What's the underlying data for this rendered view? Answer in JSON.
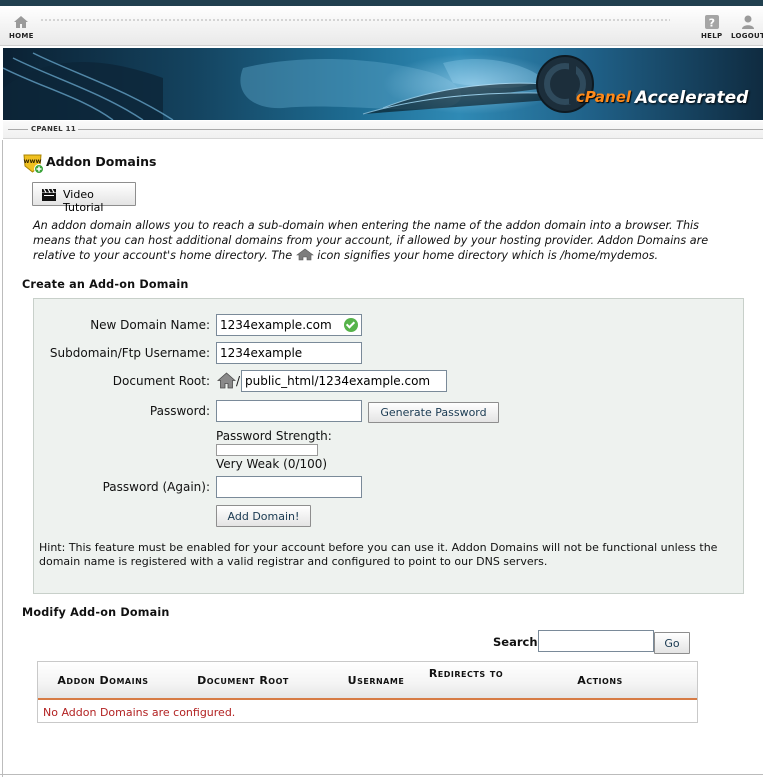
{
  "nav": {
    "home_label": "HOME",
    "help_label": "HELP",
    "logout_label": "LOGOUT"
  },
  "banner": {
    "brand_left": "cPanel",
    "brand_right": "Accelerated"
  },
  "breadcrumb": {
    "label": "CPANEL 11"
  },
  "page": {
    "title": "Addon Domains",
    "video_button": "Video Tutorial",
    "intro_part1": "An addon domain allows you to reach a sub-domain when entering the name of the addon domain into a browser. This means that you can host additional domains from your account, if allowed by your hosting provider. Addon Domains are relative to your account's home directory. The ",
    "intro_part2": " icon signifies your home directory which is /home/mydemos."
  },
  "create": {
    "heading": "Create an Add-on Domain",
    "fields": {
      "domain_label": "New Domain Name:",
      "domain_value": "1234example.com",
      "subdomain_label": "Subdomain/Ftp Username:",
      "subdomain_value": "1234example",
      "docroot_label": "Document Root:",
      "docroot_slash": "/",
      "docroot_value": "public_html/1234example.com",
      "password_label": "Password:",
      "password_value": "",
      "password_again_label": "Password (Again):",
      "password_again_value": ""
    },
    "generate_button": "Generate Password",
    "strength_label": "Password Strength:",
    "strength_value": "Very Weak (0/100)",
    "strength_score": 0,
    "add_button": "Add Domain!",
    "hint": "Hint: This feature must be enabled for your account before you can use it. Addon Domains will not be functional unless the domain name is registered with a valid registrar and configured to point to our DNS servers."
  },
  "modify": {
    "heading": "Modify Add-on Domain",
    "search_label": "Search",
    "search_value": "",
    "go_button": "Go",
    "columns": [
      "Addon Domains",
      "Document Root",
      "Username",
      "Redirects to",
      "Actions"
    ],
    "empty_message": "No Addon Domains are configured."
  },
  "colors": {
    "accent_orange": "#d67b45",
    "form_bg": "#eef2ef",
    "empty_text": "#b22222",
    "check_green": "#56b34a"
  }
}
